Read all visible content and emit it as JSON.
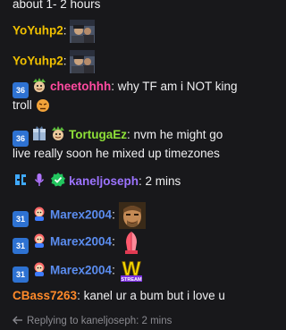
{
  "colors": {
    "background": "#18181b",
    "text": "#efeff1",
    "yoyuhp2": "#f0c000",
    "cheetohhh": "#ff4aa0",
    "tortugaez": "#8ee038",
    "kaneljoseph": "#9c73ff",
    "marex2004": "#5b8df0",
    "cbass7263": "#ff8a2a"
  },
  "top_partial": "about 1- 2 hours",
  "messages": [
    {
      "user": "YoYuhp2",
      "sep": ":",
      "emote": "avatar-photo-emote"
    },
    {
      "user": "YoYuhp2",
      "sep": ":",
      "emote": "avatar-photo-emote"
    },
    {
      "badges": [
        "sub-36",
        "goblin"
      ],
      "badge_text": "36",
      "user": "cheetohhh",
      "sep": ":",
      "text_line1": " why TF am i NOT king",
      "text_line2": "troll",
      "emote": "angry-face-emote"
    },
    {
      "badges": [
        "sub-36",
        "gift",
        "goblin"
      ],
      "badge_text": "36",
      "user": "TortugaEz",
      "sep": ":",
      "text_line1": " nvm he might go",
      "text_line2": "live really soon he mixed up timezones"
    },
    {
      "badges": [
        "bg-badge",
        "mic",
        "verified"
      ],
      "user": "kaneljoseph",
      "sep": ":",
      "text": " 2 mins"
    },
    {
      "badges": [
        "sub-31",
        "mascot"
      ],
      "badge_text": "31",
      "user": "Marex2004",
      "sep": ":",
      "emote": "face-emote"
    },
    {
      "badges": [
        "sub-31",
        "mascot"
      ],
      "badge_text": "31",
      "user": "Marex2004",
      "sep": ":",
      "emote": "praying-hands-emote"
    },
    {
      "badges": [
        "sub-31",
        "mascot"
      ],
      "badge_text": "31",
      "user": "Marex2004",
      "sep": ":",
      "emote": "w-stream-emote",
      "emote_text": "STREAM",
      "emote_letter": "W"
    },
    {
      "user": "CBass7263",
      "sep": ":",
      "text": " kanel ur a bum but i love u"
    }
  ],
  "reply_preview": "Replying to kaneljoseph: 2 mins",
  "icons": [
    "reply-arrow-icon"
  ]
}
